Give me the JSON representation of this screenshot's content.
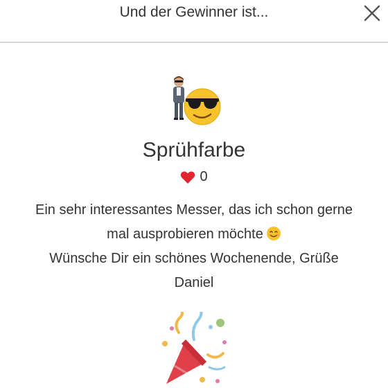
{
  "header": {
    "title": "Und der Gewinner ist..."
  },
  "winner": {
    "name": "Sprühfarbe",
    "likes": "0"
  },
  "message": {
    "line1": "Ein sehr interessantes Messer, das ich schon gerne",
    "line2": "mal ausprobieren möchte",
    "line3": "Wünsche Dir ein schönes Wochenende, Grüße",
    "line4": "Daniel"
  },
  "icons": {
    "close": "close-icon",
    "avatar": "cool-avatar-icon",
    "heart": "heart-icon",
    "smile": "smiling-face-icon",
    "party": "party-popper-icon"
  },
  "colors": {
    "heart": "#e0262e",
    "divider": "#d9d9d9",
    "text": "#333333"
  }
}
